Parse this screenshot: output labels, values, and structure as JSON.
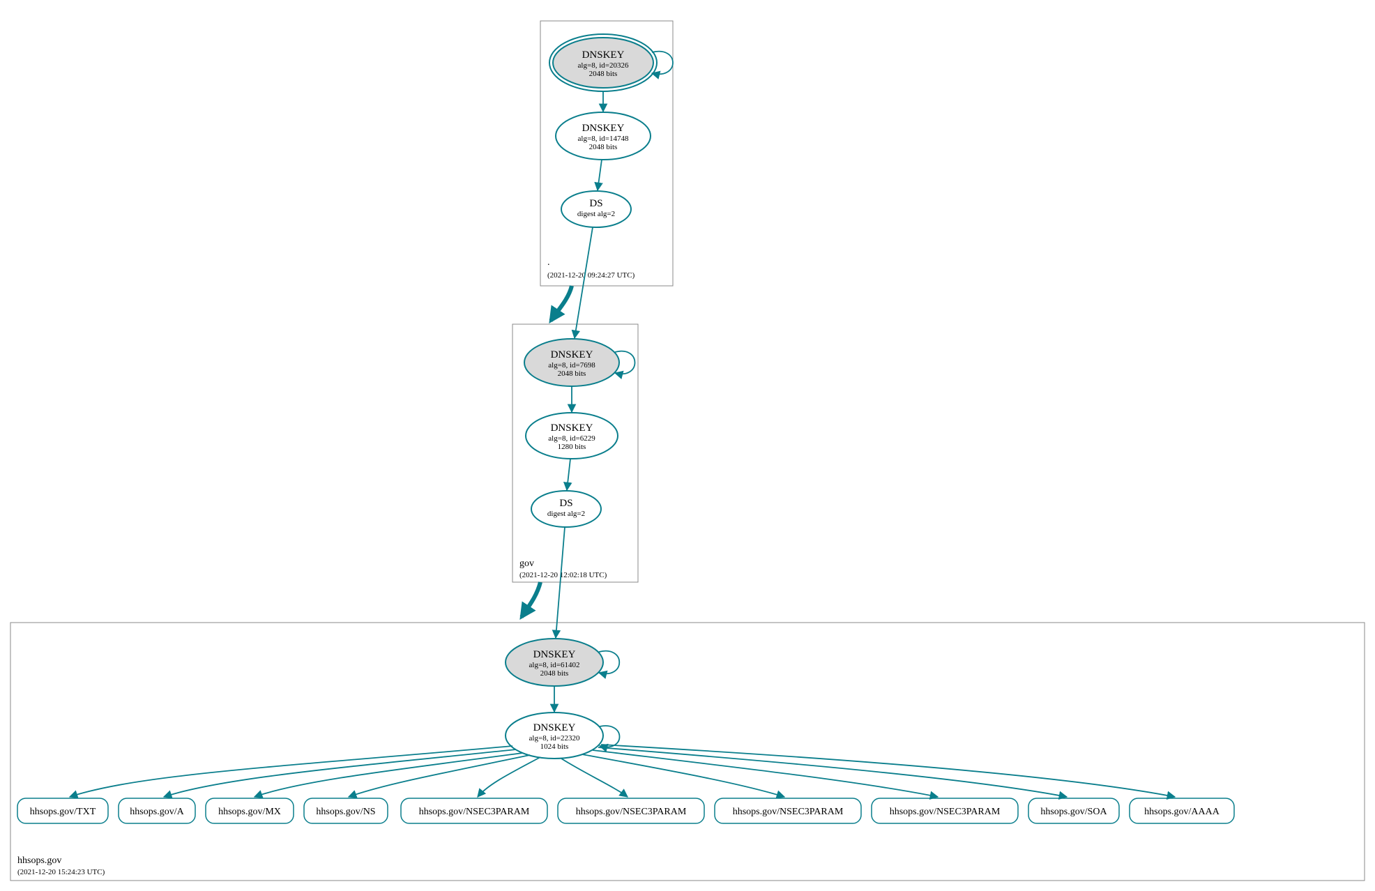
{
  "colors": {
    "line": "#0a7e8c",
    "ksk_fill": "#d9d9d9",
    "box_stroke": "#888888"
  },
  "zones": {
    "root": {
      "name": ".",
      "timestamp": "(2021-12-20 09:24:27 UTC)",
      "nodes": {
        "ksk": {
          "title": "DNSKEY",
          "line2": "alg=8, id=20326",
          "line3": "2048 bits"
        },
        "zsk": {
          "title": "DNSKEY",
          "line2": "alg=8, id=14748",
          "line3": "2048 bits"
        },
        "ds": {
          "title": "DS",
          "line2": "digest alg=2"
        }
      }
    },
    "gov": {
      "name": "gov",
      "timestamp": "(2021-12-20 12:02:18 UTC)",
      "nodes": {
        "ksk": {
          "title": "DNSKEY",
          "line2": "alg=8, id=7698",
          "line3": "2048 bits"
        },
        "zsk": {
          "title": "DNSKEY",
          "line2": "alg=8, id=6229",
          "line3": "1280 bits"
        },
        "ds": {
          "title": "DS",
          "line2": "digest alg=2"
        }
      }
    },
    "hhsops": {
      "name": "hhsops.gov",
      "timestamp": "(2021-12-20 15:24:23 UTC)",
      "nodes": {
        "ksk": {
          "title": "DNSKEY",
          "line2": "alg=8, id=61402",
          "line3": "2048 bits"
        },
        "zsk": {
          "title": "DNSKEY",
          "line2": "alg=8, id=22320",
          "line3": "1024 bits"
        }
      }
    }
  },
  "records": [
    "hhsops.gov/TXT",
    "hhsops.gov/A",
    "hhsops.gov/MX",
    "hhsops.gov/NS",
    "hhsops.gov/NSEC3PARAM",
    "hhsops.gov/NSEC3PARAM",
    "hhsops.gov/NSEC3PARAM",
    "hhsops.gov/NSEC3PARAM",
    "hhsops.gov/SOA",
    "hhsops.gov/AAAA"
  ]
}
